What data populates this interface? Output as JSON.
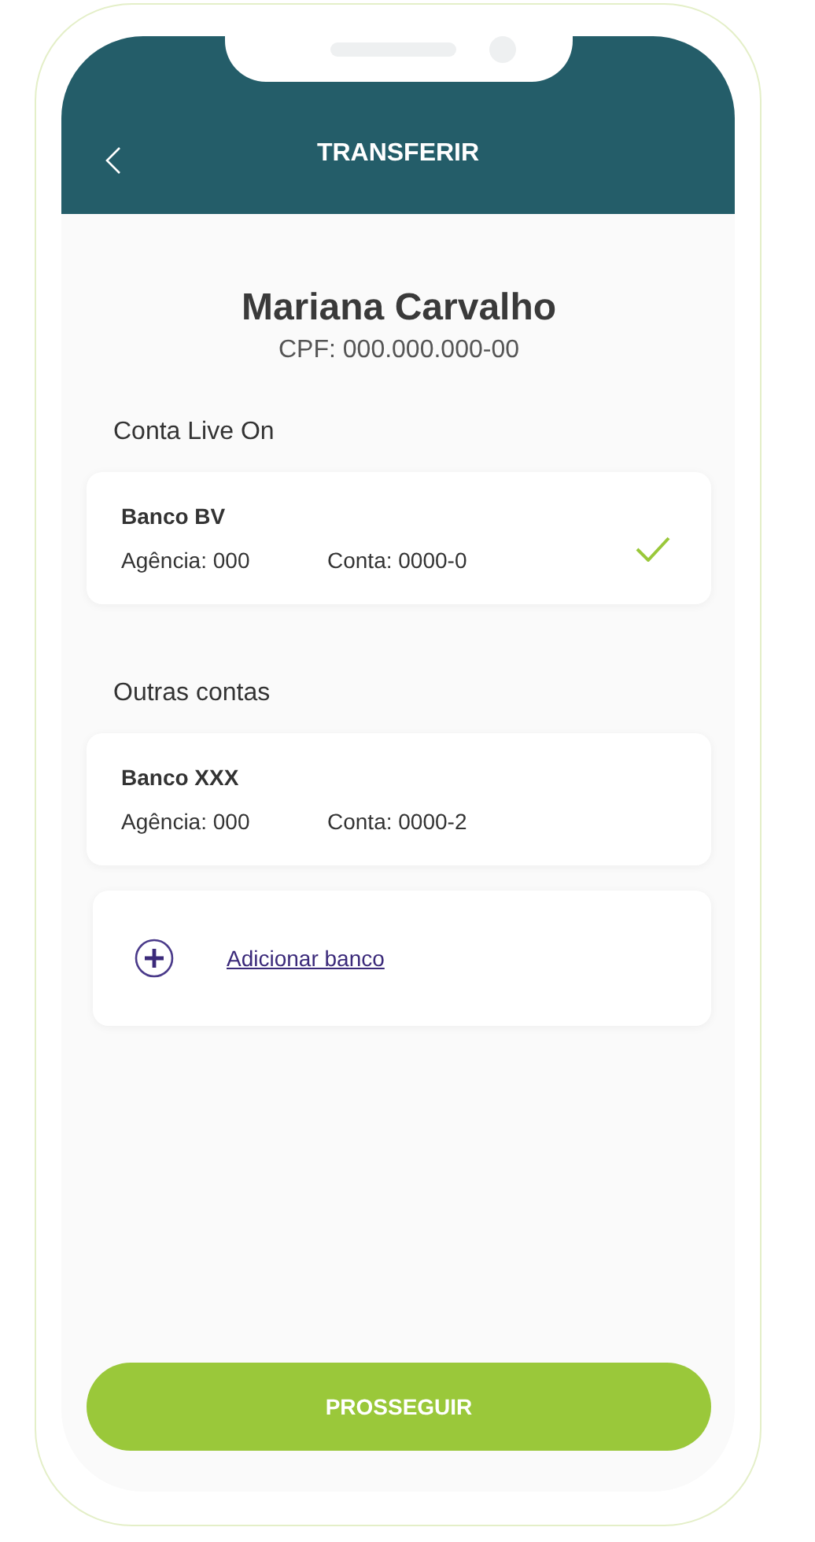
{
  "header": {
    "title": "TRANSFERIR"
  },
  "recipient": {
    "name": "Mariana Carvalho",
    "document": "CPF: 000.000.000-00"
  },
  "sections": [
    {
      "title": "Conta Live On",
      "accounts": [
        {
          "bank": "Banco BV",
          "agency": "Agência: 000",
          "account": "Conta: 0000-0",
          "selected": true
        }
      ]
    },
    {
      "title": "Outras contas",
      "accounts": [
        {
          "bank": "Banco XXX",
          "agency": "Agência: 000",
          "account": "Conta: 0000-2",
          "selected": false
        }
      ]
    }
  ],
  "add_bank": {
    "label": "Adicionar banco"
  },
  "primary_button": {
    "label": "PROSSEGUIR"
  }
}
